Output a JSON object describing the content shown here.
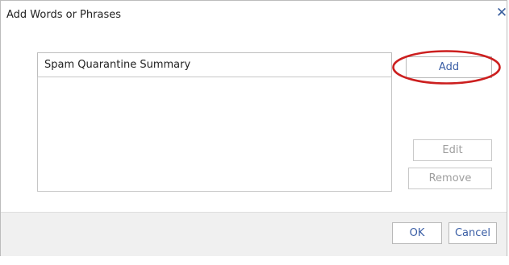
{
  "dialog": {
    "title": "Add Words or Phrases",
    "close_glyph": "✕",
    "close_icon": "close-icon"
  },
  "phrase_input": {
    "value": "Spam Quarantine Summary"
  },
  "phrase_list": {
    "items": []
  },
  "buttons": {
    "add_label": "Add",
    "edit_label": "Edit",
    "remove_label": "Remove",
    "ok_label": "OK",
    "cancel_label": "Cancel"
  },
  "annotation": {
    "color": "#cc1f1f"
  },
  "colors": {
    "button_text": "#3a5ea5",
    "disabled_text": "#9e9e9e",
    "footer_background": "#f0f0f0"
  }
}
